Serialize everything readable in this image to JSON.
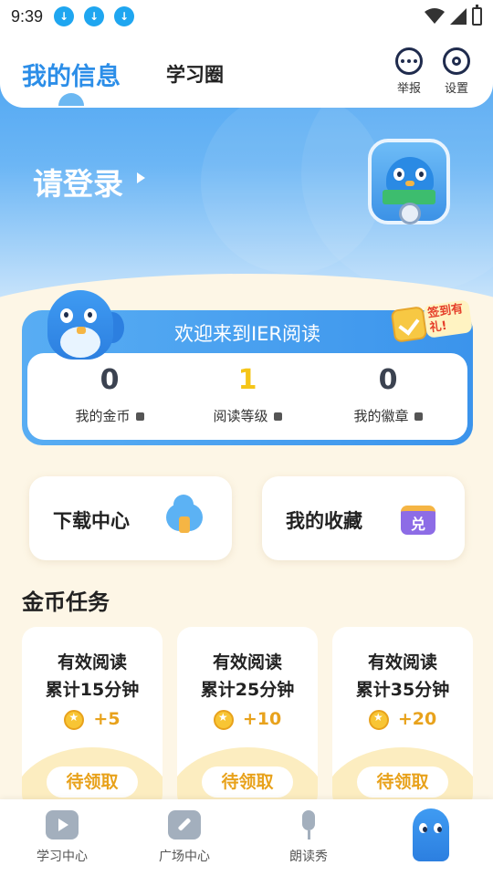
{
  "status_bar": {
    "time": "9:39"
  },
  "header": {
    "tab_active": "我的信息",
    "tab_other": "学习圈",
    "report_label": "举报",
    "settings_label": "设置"
  },
  "hero": {
    "login_text": "请登录"
  },
  "welcome": {
    "title": "欢迎来到IER阅读",
    "signin_badge": "签到有礼!",
    "stats": [
      {
        "value": "0",
        "label": "我的金币"
      },
      {
        "value": "1",
        "label": "阅读等级"
      },
      {
        "value": "0",
        "label": "我的徽章"
      }
    ]
  },
  "shortcuts": {
    "download": "下载中心",
    "favorites": "我的收藏",
    "favorites_icon_text": "兑"
  },
  "tasks_section": {
    "title": "金币任务",
    "tasks": [
      {
        "line1": "有效阅读",
        "line2": "累计15分钟",
        "reward": "+5",
        "button": "待领取"
      },
      {
        "line1": "有效阅读",
        "line2": "累计25分钟",
        "reward": "+10",
        "button": "待领取"
      },
      {
        "line1": "有效阅读",
        "line2": "累计35分钟",
        "reward": "+20",
        "button": "待领取"
      }
    ]
  },
  "bottom_nav": {
    "items": [
      {
        "label": "学习中心"
      },
      {
        "label": "广场中心"
      },
      {
        "label": "朗读秀"
      }
    ]
  },
  "colors": {
    "primary_blue": "#2c8ee8",
    "gold": "#e8a21c",
    "background": "#fdf6e6"
  }
}
